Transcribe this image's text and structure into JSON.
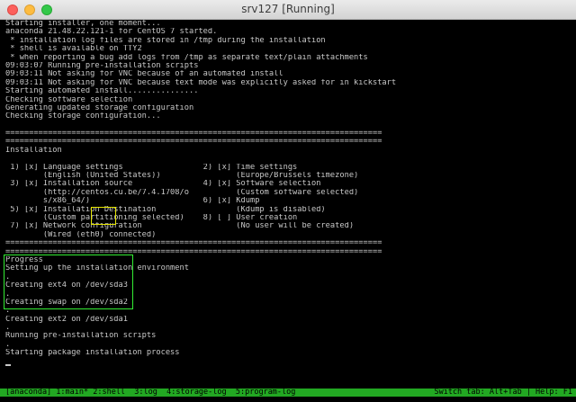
{
  "window": {
    "title": "srv127 [Running]"
  },
  "console": {
    "lines": [
      "Starting installer, one moment...",
      "anaconda 21.48.22.121-1 for CentOS 7 started.",
      " * installation log files are stored in /tmp during the installation",
      " * shell is available on TTY2",
      " * when reporting a bug add logs from /tmp as separate text/plain attachments",
      "09:03:07 Running pre-installation scripts",
      "09:03:11 Not asking for VNC because of an automated install",
      "09:03:11 Not asking for VNC because text mode was explicitly asked for in kickstart",
      "Starting automated install...............",
      "Checking software selection",
      "Generating updated storage configuration",
      "Checking storage configuration...",
      "",
      "================================================================================",
      "================================================================================",
      "Installation",
      "",
      " 1) [x] Language settings                 2) [x] Time settings",
      "        (English (United States))                (Europe/Brussels timezone)",
      " 3) [x] Installation source               4) [x] Software selection",
      "        (http://centos.cu.be/7.4.1708/o          (Custom software selected)",
      "        s/x86_64/)                        6) [x] Kdump",
      " 5) [x] Installation Destination                 (Kdump is disabled)",
      "        (Custom partitioning selected)    8) [ ] User creation",
      " 7) [x] Network configuration                    (No user will be created)",
      "        (Wired (eth0) connected)",
      "================================================================================",
      "================================================================================",
      "Progress",
      "Setting up the installation environment",
      ".",
      "Creating ext4 on /dev/sda3",
      ".",
      "Creating swap on /dev/sda2",
      ".",
      "Creating ext2 on /dev/sda1",
      ".",
      "Running pre-installation scripts",
      ".",
      "Starting package installation process"
    ]
  },
  "tmux": {
    "left": "[anaconda] 1:main* 2:shell  3:log  4:storage-log  5:program-log",
    "right": "Switch tab: Alt+Tab | Help: F1"
  },
  "colors": {
    "terminal_bg": "#000000",
    "terminal_fg": "#c8c8c8",
    "status_bar": "#22a822",
    "highlight_eth": "#e6e600",
    "highlight_progress": "#33ee33"
  }
}
